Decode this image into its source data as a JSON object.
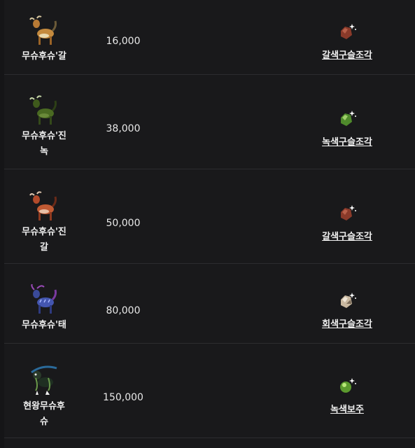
{
  "rows": [
    {
      "creature_icon": "goat-creature-brown-icon",
      "name": "무슈후슈'갈",
      "price": "16,000",
      "reward_icon": "brown-shard-icon",
      "reward": "갈색구슬조각",
      "reward_color": "#8a3a2a"
    },
    {
      "creature_icon": "goat-creature-green-icon",
      "name": "무슈후슈'진녹",
      "price": "38,000",
      "reward_icon": "green-shard-icon",
      "reward": "녹색구슬조각",
      "reward_color": "#4f8a2c"
    },
    {
      "creature_icon": "goat-creature-red-icon",
      "name": "무슈후슈'진갈",
      "price": "50,000",
      "reward_icon": "brown-shard-icon",
      "reward": "갈색구슬조각",
      "reward_color": "#8a3a2a"
    },
    {
      "creature_icon": "goat-creature-blue-icon",
      "name": "무슈후슈'태",
      "price": "80,000",
      "reward_icon": "gray-shard-icon",
      "reward": "회색구슬조각",
      "reward_color": "#c9b8a0"
    },
    {
      "creature_icon": "goat-creature-king-icon",
      "name": "현왕무슈후슈",
      "price": "150,000",
      "reward_icon": "green-orb-icon",
      "reward": "녹색보주",
      "reward_color": "#5c9a2e"
    }
  ]
}
